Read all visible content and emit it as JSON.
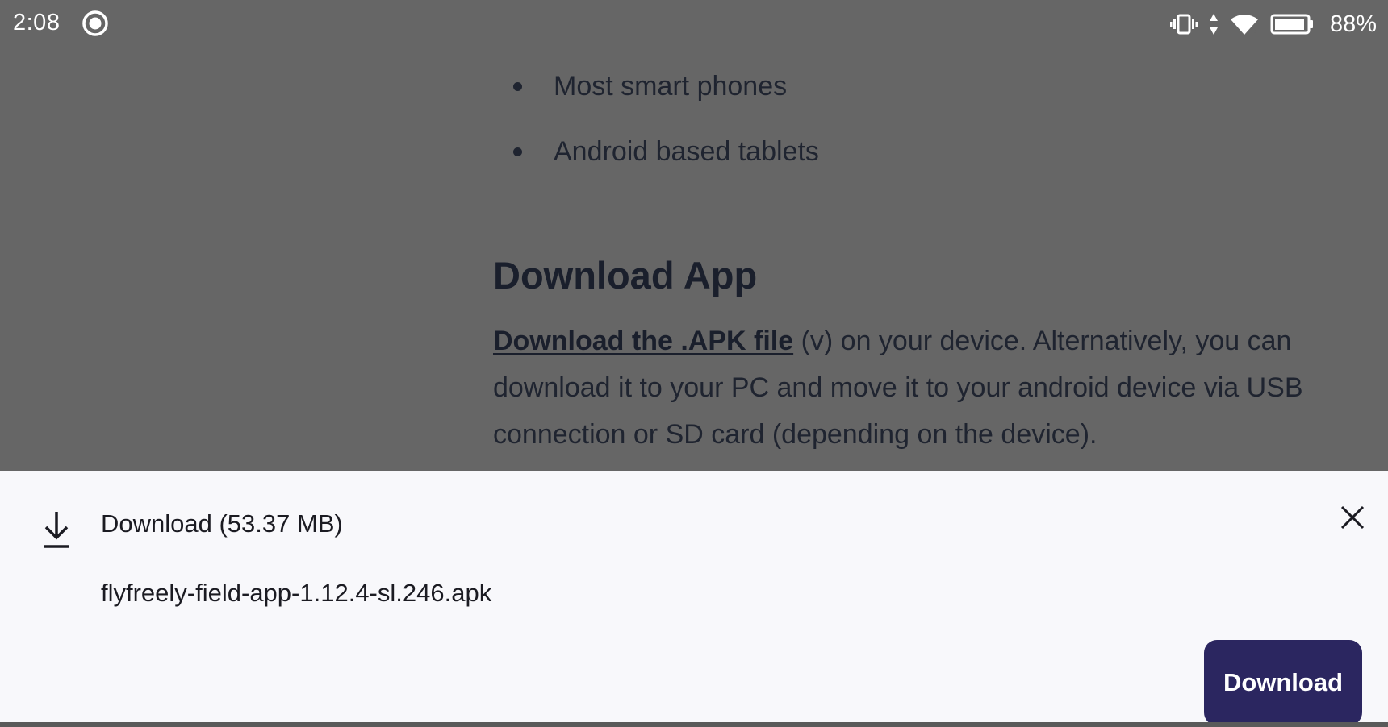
{
  "status_bar": {
    "time": "2:08",
    "battery_percent": "88%",
    "icons": [
      "screen-record-icon",
      "vibrate-icon",
      "data-arrows-icon",
      "wifi-icon",
      "battery-icon"
    ]
  },
  "page": {
    "bullets": [
      "Most smart phones",
      "Android based tablets"
    ],
    "heading": "Download App",
    "link_text": "Download the .APK file",
    "paragraph_rest": " (v) on your device. Alternatively, you can download it to your PC and move it to your android device via USB connection or SD card (depending on the device)."
  },
  "download_sheet": {
    "title": "Download (53.37 MB)",
    "filename": "flyfreely-field-app-1.12.4-sl.246.apk",
    "download_button": "Download",
    "accent_color": "#2b2660"
  }
}
